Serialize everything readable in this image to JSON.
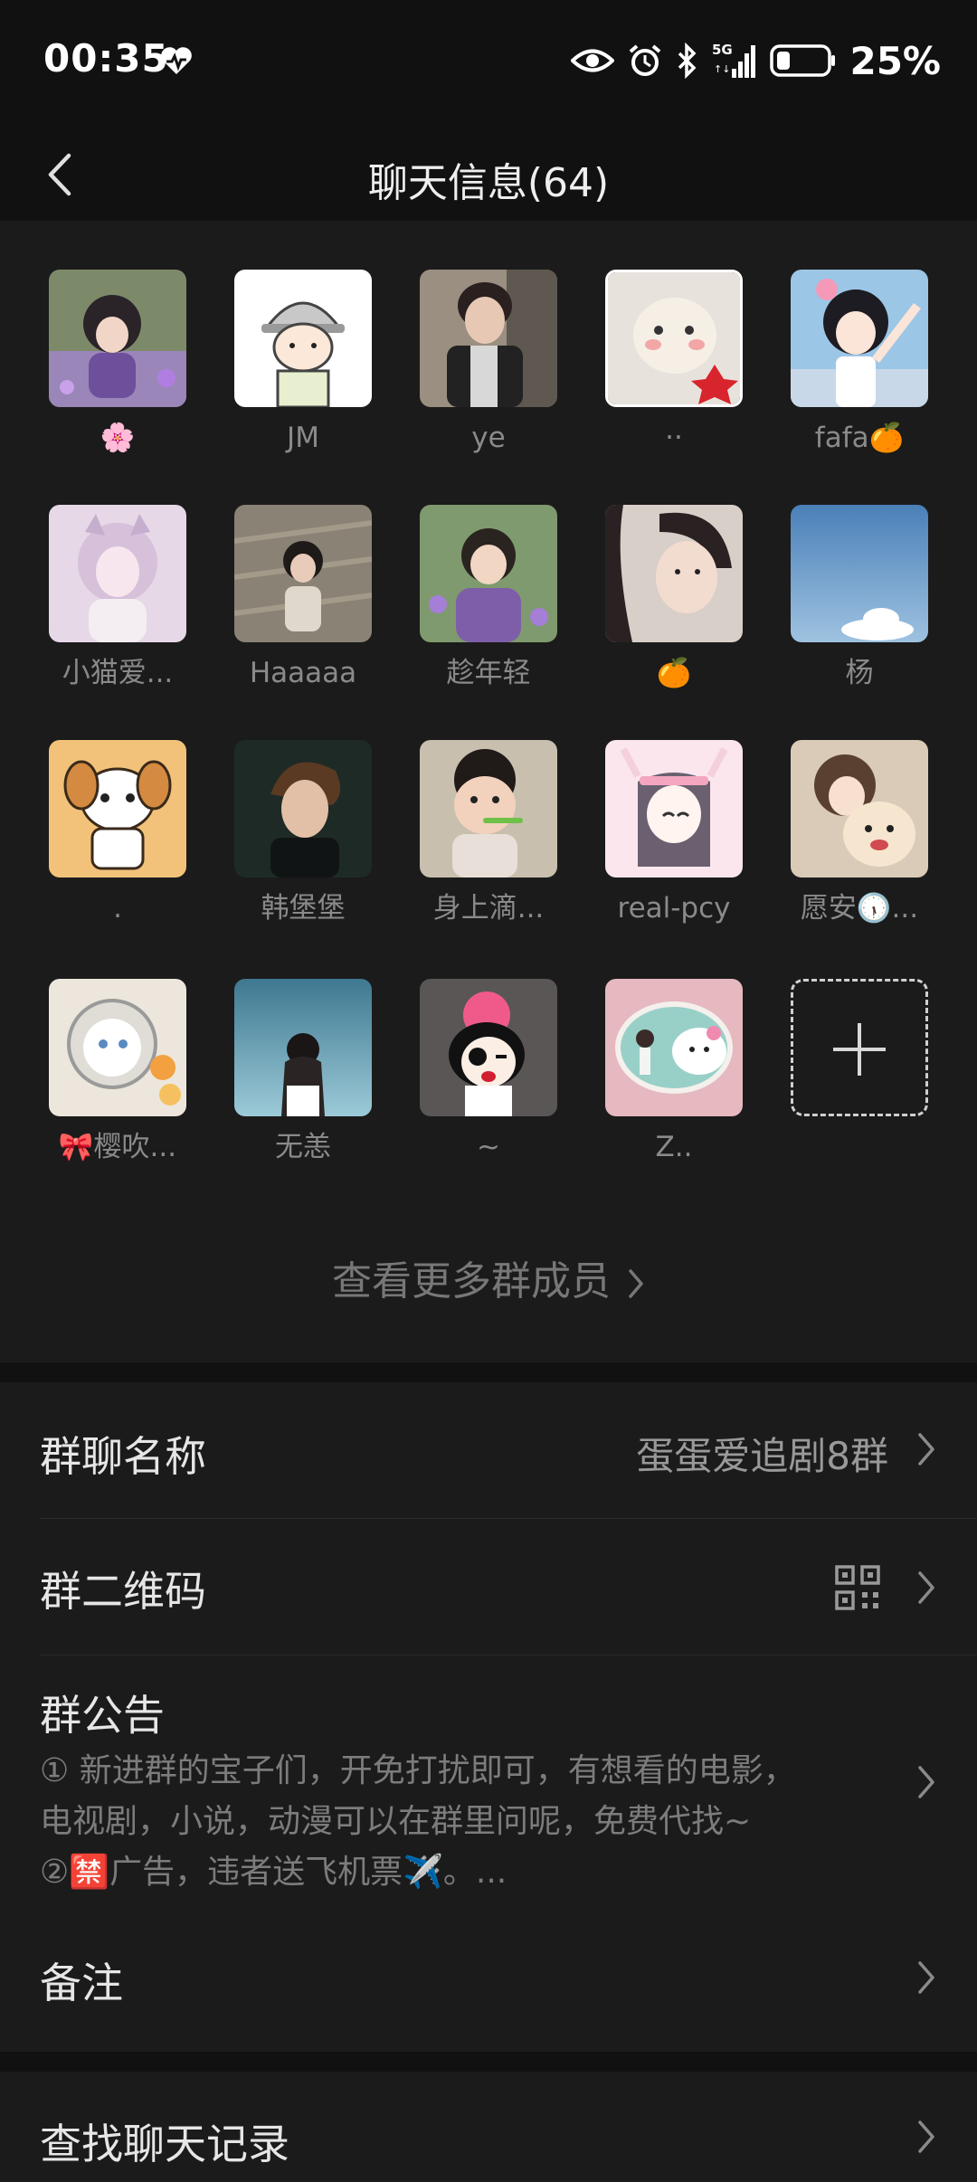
{
  "status_bar": {
    "time": "00:35",
    "network": "5G",
    "battery_percent": "25%",
    "battery_level": 0.25
  },
  "header": {
    "title": "聊天信息(64)"
  },
  "members": [
    {
      "name": "🌸"
    },
    {
      "name": "JM"
    },
    {
      "name": "ye"
    },
    {
      "name": "··"
    },
    {
      "name": "fafa🍊"
    },
    {
      "name": "小猫爱..."
    },
    {
      "name": "Haaaaa"
    },
    {
      "name": "趁年轻"
    },
    {
      "name": "🍊"
    },
    {
      "name": "杨"
    },
    {
      "name": "."
    },
    {
      "name": "韩堡堡"
    },
    {
      "name": "身上滴..."
    },
    {
      "name": "real-pcy"
    },
    {
      "name": "愿安🕠..."
    },
    {
      "name": "🎀樱吹..."
    },
    {
      "name": "无恙"
    },
    {
      "name": "~"
    },
    {
      "name": "Z.."
    }
  ],
  "more_members_label": "查看更多群成员",
  "settings": {
    "group_name_label": "群聊名称",
    "group_name_value": "蛋蛋爱追剧8群",
    "qr_label": "群二维码",
    "notice_label": "群公告",
    "notice_line1": "① 新进群的宝子们，开免打扰即可，有想看的电影，",
    "notice_line2": "电视剧，小说，动漫可以在群里问呢，免费代找~",
    "notice_line3": "②🈲广告，违者送飞机票✈️。...",
    "remark_label": "备注",
    "search_label": "查找聊天记录"
  },
  "colors": {
    "background": "#111111",
    "panel": "#1b1b1b",
    "primary_text": "#e6e6e6",
    "secondary_text": "#8a8a8a"
  }
}
